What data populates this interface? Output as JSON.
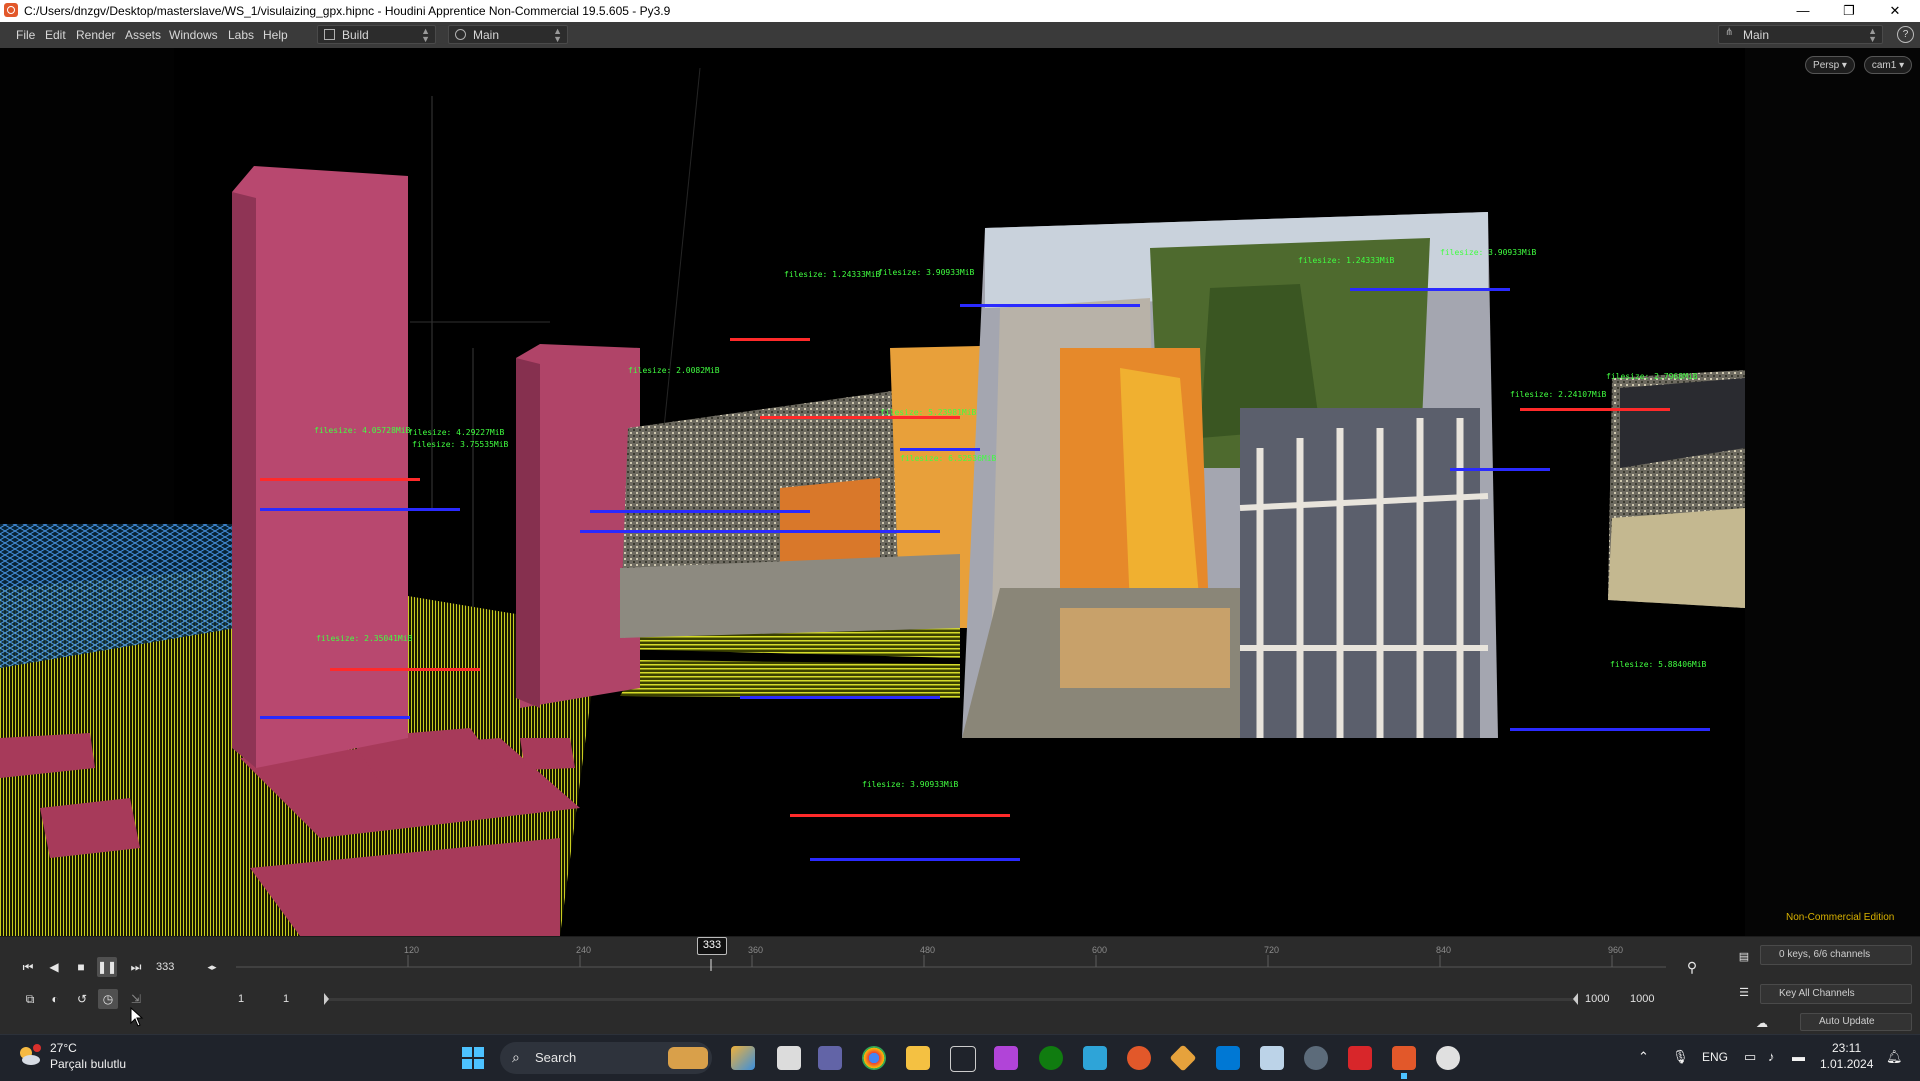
{
  "window": {
    "title": "C:/Users/dnzgv/Desktop/masterslave/WS_1/visulaizing_gpx.hipnc - Houdini Apprentice Non-Commercial 19.5.605 - Py3.9",
    "minimize": "—",
    "maximize": "❐",
    "close": "✕"
  },
  "menubar": {
    "items": [
      "File",
      "Edit",
      "Render",
      "Assets",
      "Windows",
      "Labs",
      "Help"
    ],
    "desktop_build": "Build",
    "desktop_main": "Main",
    "right_desktop": "Main",
    "help_icon": "?"
  },
  "viewport": {
    "persp_label": "Persp ▾",
    "cam_label": "cam1 ▾",
    "edition_label": "Non-Commercial Edition",
    "overlay_labels": [
      "filesize: 1.24333MiB",
      "filesize: 3.90933MiB",
      "filesize: 1.24333MiB",
      "filesize: 3.90933MiB",
      "filesize: 4.05728MiB",
      "filesize: 4.29227MiB",
      "filesize: 3.75535MiB",
      "filesize: 2.0082MiB",
      "filesize: 5.23981MiB",
      "filesize: 6.52536MiB",
      "filesize: 2.24107MiB",
      "filesize: 2.7968MiB",
      "filesize: 5.88406MiB",
      "filesize: 3.90933MiB",
      "filesize: 2.35041MiB"
    ]
  },
  "timeline": {
    "current_frame": "333",
    "cursor_frame": "333",
    "ticks": [
      "120",
      "240",
      "360",
      "480",
      "600",
      "720",
      "840",
      "960"
    ],
    "range_start": "1",
    "range_start2": "1",
    "range_end": "1000",
    "range_end2": "1000",
    "keys_channels": "0 keys, 6/6 channels",
    "key_all": "Key All Channels",
    "auto_update": "Auto Update"
  },
  "taskbar": {
    "temperature": "27°C",
    "weather_desc": "Parçalı bulutlu",
    "search_label": "Search",
    "language": "ENG",
    "time": "23:11",
    "date": "1.01.2024"
  },
  "colors": {
    "label_green": "#41ff41",
    "label_red": "#ff2a2a",
    "label_blue": "#2a2aff",
    "pillar": "#b8486f",
    "grid_yellow": "#c8cc20"
  }
}
